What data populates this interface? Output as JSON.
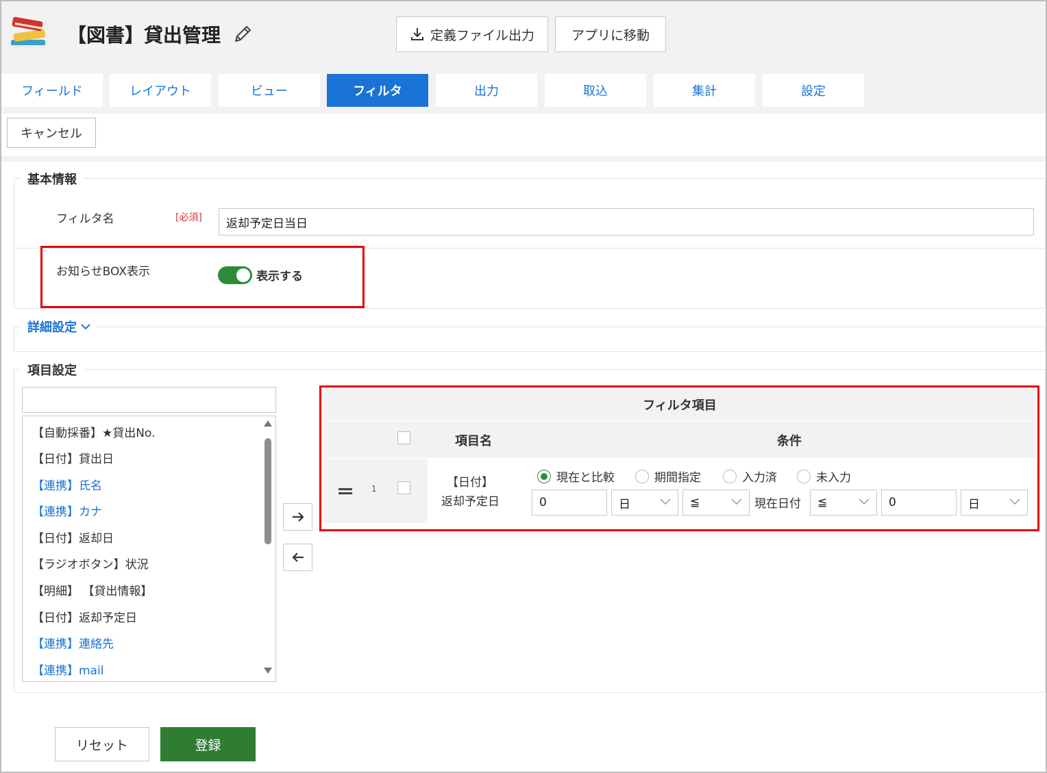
{
  "header": {
    "app_title": "【図書】貸出管理",
    "export_label": "定義ファイル出力",
    "goto_app_label": "アプリに移動"
  },
  "tabs": [
    {
      "label": "フィールド",
      "active": false
    },
    {
      "label": "レイアウト",
      "active": false
    },
    {
      "label": "ビュー",
      "active": false
    },
    {
      "label": "フィルタ",
      "active": true
    },
    {
      "label": "出力",
      "active": false
    },
    {
      "label": "取込",
      "active": false
    },
    {
      "label": "集計",
      "active": false
    },
    {
      "label": "設定",
      "active": false
    }
  ],
  "cancel_label": "キャンセル",
  "basic_info": {
    "title": "基本情報",
    "filter_name_label": "フィルタ名",
    "required_label": "[必須]",
    "filter_name_value": "返却予定日当日",
    "notice_label": "お知らせBOX表示",
    "notice_toggle_on": true,
    "notice_toggle_label": "表示する"
  },
  "detail_settings_label": "詳細設定",
  "item_settings": {
    "title": "項目設定",
    "search_value": "",
    "fields": [
      {
        "label": "【自動採番】★貸出No.",
        "linked": false
      },
      {
        "label": "【日付】貸出日",
        "linked": false
      },
      {
        "label": "【連携】氏名",
        "linked": true
      },
      {
        "label": "【連携】カナ",
        "linked": true
      },
      {
        "label": "【日付】返却日",
        "linked": false
      },
      {
        "label": "【ラジオボタン】状況",
        "linked": false
      },
      {
        "label": "【明細】 【貸出情報】",
        "linked": false
      },
      {
        "label": "【日付】返却予定日",
        "linked": false
      },
      {
        "label": "【連携】連絡先",
        "linked": true
      },
      {
        "label": "【連携】mail",
        "linked": true
      }
    ]
  },
  "filter_table": {
    "title": "フィルタ項目",
    "col_name": "項目名",
    "col_condition": "条件",
    "rows": [
      {
        "number": "1",
        "name_line1": "【日付】",
        "name_line2": "返却予定日",
        "options": [
          "現在と比較",
          "期間指定",
          "入力済",
          "未入力"
        ],
        "selected_option": "現在と比較",
        "value1": "0",
        "unit1": "日",
        "operator1": "≦",
        "current_date_label": "現在日付",
        "operator2": "≦",
        "value2": "0",
        "unit2": "日"
      }
    ]
  },
  "footer": {
    "reset_label": "リセット",
    "register_label": "登録"
  },
  "colors": {
    "primary_blue": "#1a73d6",
    "green": "#2e7d32",
    "highlight_red": "#e60000"
  }
}
